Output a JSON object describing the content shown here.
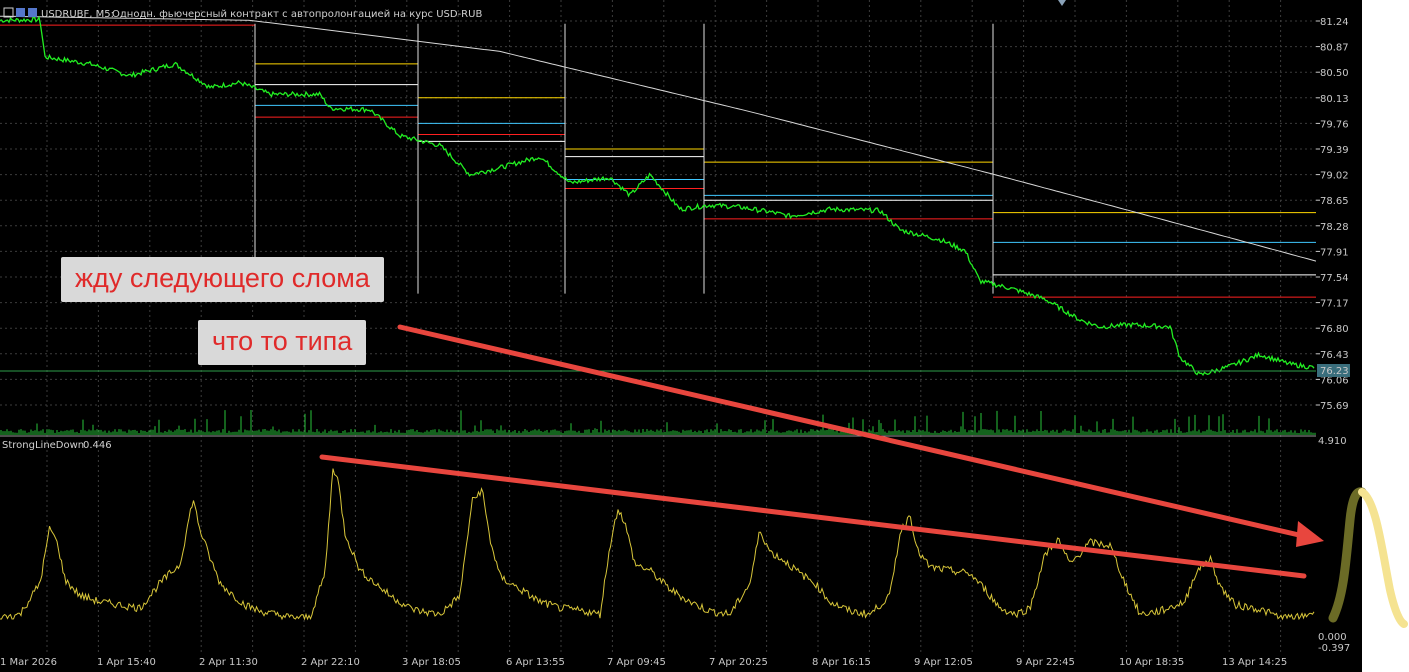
{
  "header": {
    "symbol": "USDRUBF, M5:",
    "description": "Однодн. фьючерсный контракт с автопролонгацией на курс USD-RUB"
  },
  "indicator": {
    "name": "StrongLineDown",
    "value": "0.446",
    "scale_top": "4.910",
    "scale_zero": "0.000",
    "scale_bottom": "-0.397"
  },
  "annotations": {
    "note1": "жду следующего слома",
    "note2": "что то типа"
  },
  "chart_data": [
    {
      "type": "line",
      "series": [
        {
          "color": "#22ee22"
        }
      ],
      "y_ticks": [
        "81.24",
        "80.87",
        "80.50",
        "80.13",
        "79.76",
        "79.39",
        "79.02",
        "78.65",
        "78.28",
        "77.91",
        "77.54",
        "77.17",
        "76.80",
        "76.43",
        "76.06",
        "75.69"
      ],
      "ylim": [
        75.5,
        81.38
      ],
      "x_tick_labels": [
        "1 Mar 2026",
        "1 Apr 15:40",
        "2 Apr 11:30",
        "2 Apr 22:10",
        "3 Apr 18:05",
        "6 Apr 13:55",
        "7 Apr 09:45",
        "7 Apr 20:25",
        "8 Apr 16:15",
        "9 Apr 12:05",
        "9 Apr 22:45",
        "10 Apr 18:35",
        "13 Apr 14:25"
      ],
      "current_price": "76.23",
      "price_keypoints": [
        [
          0,
          81.25
        ],
        [
          40,
          81.26
        ],
        [
          45,
          80.72
        ],
        [
          90,
          80.62
        ],
        [
          130,
          80.45
        ],
        [
          175,
          80.62
        ],
        [
          210,
          80.28
        ],
        [
          240,
          80.35
        ],
        [
          270,
          80.18
        ],
        [
          320,
          80.18
        ],
        [
          330,
          79.98
        ],
        [
          370,
          79.96
        ],
        [
          400,
          79.58
        ],
        [
          440,
          79.44
        ],
        [
          470,
          79.02
        ],
        [
          500,
          79.12
        ],
        [
          540,
          79.28
        ],
        [
          570,
          78.9
        ],
        [
          610,
          78.98
        ],
        [
          630,
          78.72
        ],
        [
          650,
          79.02
        ],
        [
          680,
          78.52
        ],
        [
          710,
          78.58
        ],
        [
          740,
          78.55
        ],
        [
          770,
          78.48
        ],
        [
          790,
          78.42
        ],
        [
          830,
          78.52
        ],
        [
          880,
          78.5
        ],
        [
          900,
          78.22
        ],
        [
          940,
          78.08
        ],
        [
          965,
          77.92
        ],
        [
          980,
          77.48
        ],
        [
          1010,
          77.38
        ],
        [
          1045,
          77.22
        ],
        [
          1080,
          76.92
        ],
        [
          1100,
          76.82
        ],
        [
          1130,
          76.85
        ],
        [
          1170,
          76.82
        ],
        [
          1180,
          76.38
        ],
        [
          1200,
          76.12
        ],
        [
          1230,
          76.25
        ],
        [
          1260,
          76.42
        ],
        [
          1290,
          76.28
        ],
        [
          1315,
          76.23
        ]
      ],
      "ma_keypoints": [
        [
          0,
          81.31
        ],
        [
          250,
          81.25
        ],
        [
          500,
          80.8
        ],
        [
          750,
          79.93
        ],
        [
          1000,
          79.0
        ],
        [
          1150,
          78.42
        ],
        [
          1316,
          77.77
        ]
      ],
      "levels": [
        {
          "color": "#ffd700",
          "x1": 255,
          "x2": 418,
          "y": 80.62
        },
        {
          "color": "#ffd700",
          "x1": 418,
          "x2": 565,
          "y": 80.13
        },
        {
          "color": "#ffd700",
          "x1": 565,
          "x2": 704,
          "y": 79.39
        },
        {
          "color": "#ffd700",
          "x1": 704,
          "x2": 993,
          "y": 79.2
        },
        {
          "color": "#ffd700",
          "x1": 993,
          "x2": 1316,
          "y": 78.47
        },
        {
          "color": "#ffffff",
          "x1": 255,
          "x2": 418,
          "y": 80.32
        },
        {
          "color": "#ffffff",
          "x1": 418,
          "x2": 565,
          "y": 79.5
        },
        {
          "color": "#ffffff",
          "x1": 565,
          "x2": 704,
          "y": 79.28
        },
        {
          "color": "#ffffff",
          "x1": 704,
          "x2": 993,
          "y": 78.65
        },
        {
          "color": "#ffffff",
          "x1": 993,
          "x2": 1316,
          "y": 77.57
        },
        {
          "color": "#40c8ff",
          "x1": 255,
          "x2": 418,
          "y": 80.02
        },
        {
          "color": "#40c8ff",
          "x1": 418,
          "x2": 565,
          "y": 79.76
        },
        {
          "color": "#40c8ff",
          "x1": 565,
          "x2": 704,
          "y": 78.95
        },
        {
          "color": "#40c8ff",
          "x1": 704,
          "x2": 993,
          "y": 78.72
        },
        {
          "color": "#40c8ff",
          "x1": 993,
          "x2": 1316,
          "y": 78.04
        },
        {
          "color": "#ff2020",
          "x1": 0,
          "x2": 255,
          "y": 81.18
        },
        {
          "color": "#ff2020",
          "x1": 255,
          "x2": 418,
          "y": 79.85
        },
        {
          "color": "#ff2020",
          "x1": 418,
          "x2": 565,
          "y": 79.6
        },
        {
          "color": "#ff2020",
          "x1": 565,
          "x2": 704,
          "y": 78.82
        },
        {
          "color": "#ff2020",
          "x1": 704,
          "x2": 993,
          "y": 78.38
        },
        {
          "color": "#ff2020",
          "x1": 993,
          "x2": 1316,
          "y": 77.25
        }
      ],
      "level_breaks": [
        255,
        418,
        565,
        704,
        993
      ]
    },
    {
      "type": "line",
      "series": [
        {
          "name": "StrongLineDown",
          "color": "#d8c63a"
        }
      ],
      "ylim": [
        -0.397,
        4.91
      ],
      "keypoints": [
        [
          0,
          0.1
        ],
        [
          20,
          0.2
        ],
        [
          40,
          1.2
        ],
        [
          50,
          3.0
        ],
        [
          58,
          2.4
        ],
        [
          65,
          1.3
        ],
        [
          80,
          0.8
        ],
        [
          100,
          0.6
        ],
        [
          120,
          0.5
        ],
        [
          140,
          0.4
        ],
        [
          160,
          1.2
        ],
        [
          180,
          1.8
        ],
        [
          193,
          3.9
        ],
        [
          200,
          2.9
        ],
        [
          210,
          2.0
        ],
        [
          220,
          1.2
        ],
        [
          230,
          0.9
        ],
        [
          245,
          0.5
        ],
        [
          260,
          0.3
        ],
        [
          290,
          0.1
        ],
        [
          310,
          0.1
        ],
        [
          325,
          1.5
        ],
        [
          333,
          4.9
        ],
        [
          338,
          4.5
        ],
        [
          345,
          2.8
        ],
        [
          360,
          1.6
        ],
        [
          390,
          0.8
        ],
        [
          410,
          0.4
        ],
        [
          420,
          0.3
        ],
        [
          440,
          0.2
        ],
        [
          460,
          0.8
        ],
        [
          472,
          3.8
        ],
        [
          482,
          4.2
        ],
        [
          490,
          2.6
        ],
        [
          500,
          1.4
        ],
        [
          520,
          1.0
        ],
        [
          540,
          0.6
        ],
        [
          560,
          0.4
        ],
        [
          585,
          0.3
        ],
        [
          600,
          0.2
        ],
        [
          610,
          2.4
        ],
        [
          618,
          3.6
        ],
        [
          625,
          3.1
        ],
        [
          635,
          1.8
        ],
        [
          650,
          1.6
        ],
        [
          670,
          1.0
        ],
        [
          690,
          0.6
        ],
        [
          710,
          0.3
        ],
        [
          730,
          0.2
        ],
        [
          750,
          1.2
        ],
        [
          760,
          2.9
        ],
        [
          770,
          2.2
        ],
        [
          785,
          1.9
        ],
        [
          800,
          1.5
        ],
        [
          815,
          1.2
        ],
        [
          830,
          0.6
        ],
        [
          850,
          0.3
        ],
        [
          870,
          0.2
        ],
        [
          890,
          0.8
        ],
        [
          900,
          2.8
        ],
        [
          910,
          3.4
        ],
        [
          918,
          2.2
        ],
        [
          930,
          1.7
        ],
        [
          950,
          1.6
        ],
        [
          970,
          1.5
        ],
        [
          985,
          1.0
        ],
        [
          1000,
          0.4
        ],
        [
          1015,
          0.2
        ],
        [
          1030,
          0.4
        ],
        [
          1045,
          2.1
        ],
        [
          1058,
          2.6
        ],
        [
          1070,
          1.8
        ],
        [
          1090,
          2.5
        ],
        [
          1110,
          2.4
        ],
        [
          1125,
          1.2
        ],
        [
          1140,
          0.2
        ],
        [
          1160,
          0.3
        ],
        [
          1185,
          0.6
        ],
        [
          1195,
          1.5
        ],
        [
          1210,
          2.0
        ],
        [
          1220,
          1.1
        ],
        [
          1235,
          0.5
        ],
        [
          1255,
          0.4
        ],
        [
          1265,
          0.3
        ],
        [
          1280,
          0.1
        ],
        [
          1300,
          0.1
        ],
        [
          1315,
          0.3
        ]
      ]
    }
  ]
}
